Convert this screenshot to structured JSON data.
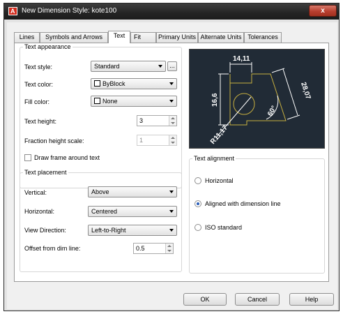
{
  "window": {
    "title": "New Dimension Style: kote100",
    "icon": "autocad-icon",
    "close_label": "x"
  },
  "tabs": [
    {
      "label": "Lines",
      "active": false
    },
    {
      "label": "Symbols and Arrows",
      "active": false
    },
    {
      "label": "Text",
      "active": true
    },
    {
      "label": "Fit",
      "active": false
    },
    {
      "label": "Primary Units",
      "active": false
    },
    {
      "label": "Alternate Units",
      "active": false
    },
    {
      "label": "Tolerances",
      "active": false
    }
  ],
  "text_appearance": {
    "title": "Text appearance",
    "style_label": "Text style:",
    "style_value": "Standard",
    "style_button": "...",
    "color_label": "Text color:",
    "color_value": "ByBlock",
    "fill_label": "Fill color:",
    "fill_value": "None",
    "height_label": "Text height:",
    "height_value": "3",
    "fraction_label": "Fraction height scale:",
    "fraction_value": "1",
    "frame_label": "Draw frame around text",
    "frame_checked": false
  },
  "text_placement": {
    "title": "Text placement",
    "vertical_label": "Vertical:",
    "vertical_value": "Above",
    "horizontal_label": "Horizontal:",
    "horizontal_value": "Centered",
    "view_label": "View Direction:",
    "view_value": "Left-to-Right",
    "offset_label": "Offset from dim line:",
    "offset_value": "0.5"
  },
  "preview": {
    "dim_top": "14,11",
    "dim_left": "16,6",
    "dim_right": "28,07",
    "dim_angle": "60°",
    "dim_radius": "R11,17",
    "colors": {
      "background": "#212b36",
      "geometry": "#c8b040",
      "dimension": "#ffffff"
    }
  },
  "text_alignment": {
    "title": "Text alignment",
    "options": [
      {
        "label": "Horizontal",
        "selected": false
      },
      {
        "label": "Aligned with dimension line",
        "selected": true
      },
      {
        "label": "ISO standard",
        "selected": false
      }
    ]
  },
  "buttons": {
    "ok": "OK",
    "cancel": "Cancel",
    "help": "Help"
  }
}
